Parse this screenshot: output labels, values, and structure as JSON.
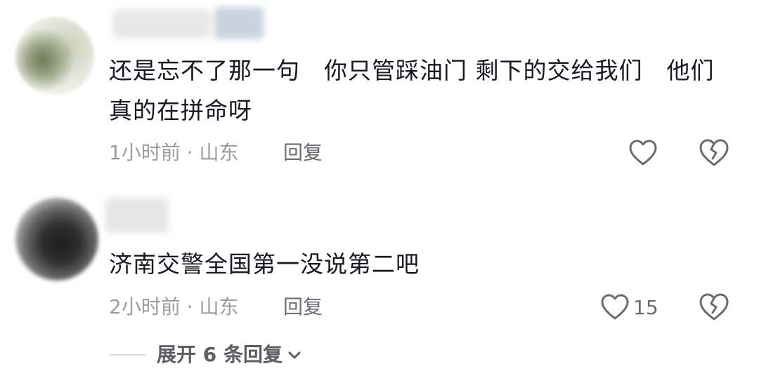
{
  "comments": [
    {
      "text": "还是忘不了那一句　你只管踩油门  剩下的交给我们　他们真的在拼命呀",
      "meta": "1小时前 · 山东",
      "reply_label": "回复",
      "like_count": ""
    },
    {
      "text": "济南交警全国第一没说第二吧",
      "meta": "2小时前 · 山东",
      "reply_label": "回复",
      "like_count": "15"
    }
  ],
  "expand_replies_label": "展开 6 条回复",
  "icons": {
    "like": "heart-outline-icon",
    "dislike": "broken-heart-icon",
    "expand": "chevron-down-icon"
  },
  "colors": {
    "text_primary": "#161823",
    "text_secondary": "#9b9ba1",
    "icon": "#6b6b73"
  }
}
